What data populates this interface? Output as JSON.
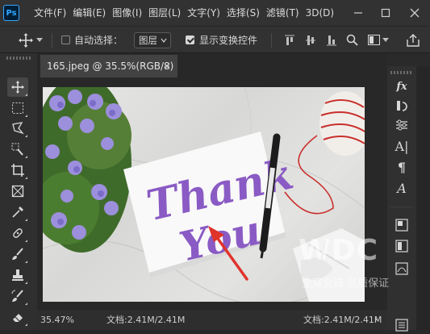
{
  "app": {
    "logo_text": "Ps"
  },
  "menu": {
    "items": [
      "文件(F)",
      "编辑(E)",
      "图像(I)",
      "图层(L)",
      "文字(Y)",
      "选择(S)",
      "滤镜(T)",
      "3D(D)"
    ]
  },
  "window_controls": [
    "minimize-icon",
    "maximize-icon",
    "close-icon"
  ],
  "options_bar": {
    "tool_icon": "move-icon",
    "auto_select_checked": false,
    "auto_select_label": "自动选择：",
    "auto_select_target": "图层",
    "show_transform_checked": true,
    "show_transform_label": "显示变换控件",
    "align_icons": [
      "align-top-icon",
      "align-vcenter-icon",
      "align-bottom-icon",
      "align-left-icon",
      "more-icon"
    ],
    "right_icons": [
      "search-icon",
      "workspace-icon",
      "share-icon"
    ]
  },
  "tools": [
    "move-tool-icon",
    "marquee-tool-icon",
    "lasso-tool-icon",
    "quick-select-tool-icon",
    "crop-tool-icon",
    "frame-tool-icon",
    "eyedropper-tool-icon",
    "healing-brush-icon",
    "brush-tool-icon",
    "clone-stamp-icon",
    "history-brush-icon",
    "eraser-tool-icon"
  ],
  "document": {
    "tab_title": "165.jpeg @ 35.5%(RGB/8)",
    "close_symbol": "×"
  },
  "image": {
    "card_text_line1": "Thank",
    "card_text_line2": "You",
    "accent_purple": "#8a5bc4",
    "arrow_color": "#e0332b"
  },
  "status": {
    "zoom": "35.47%",
    "doc_info": "文档:2.41M/2.41M",
    "doc_info_right": "文档:2.41M/2.41M"
  },
  "right_panel": {
    "icons": [
      "fx-icon",
      "history-icon",
      "adjustments-icon",
      "character-icon",
      "paragraph-icon",
      "glyphs-icon",
      "layers-icon",
      "channels-icon",
      "paths-icon",
      "properties-icon"
    ]
  },
  "watermark": {
    "text": "WDC",
    "sub": "全真全诚  品质保证"
  }
}
